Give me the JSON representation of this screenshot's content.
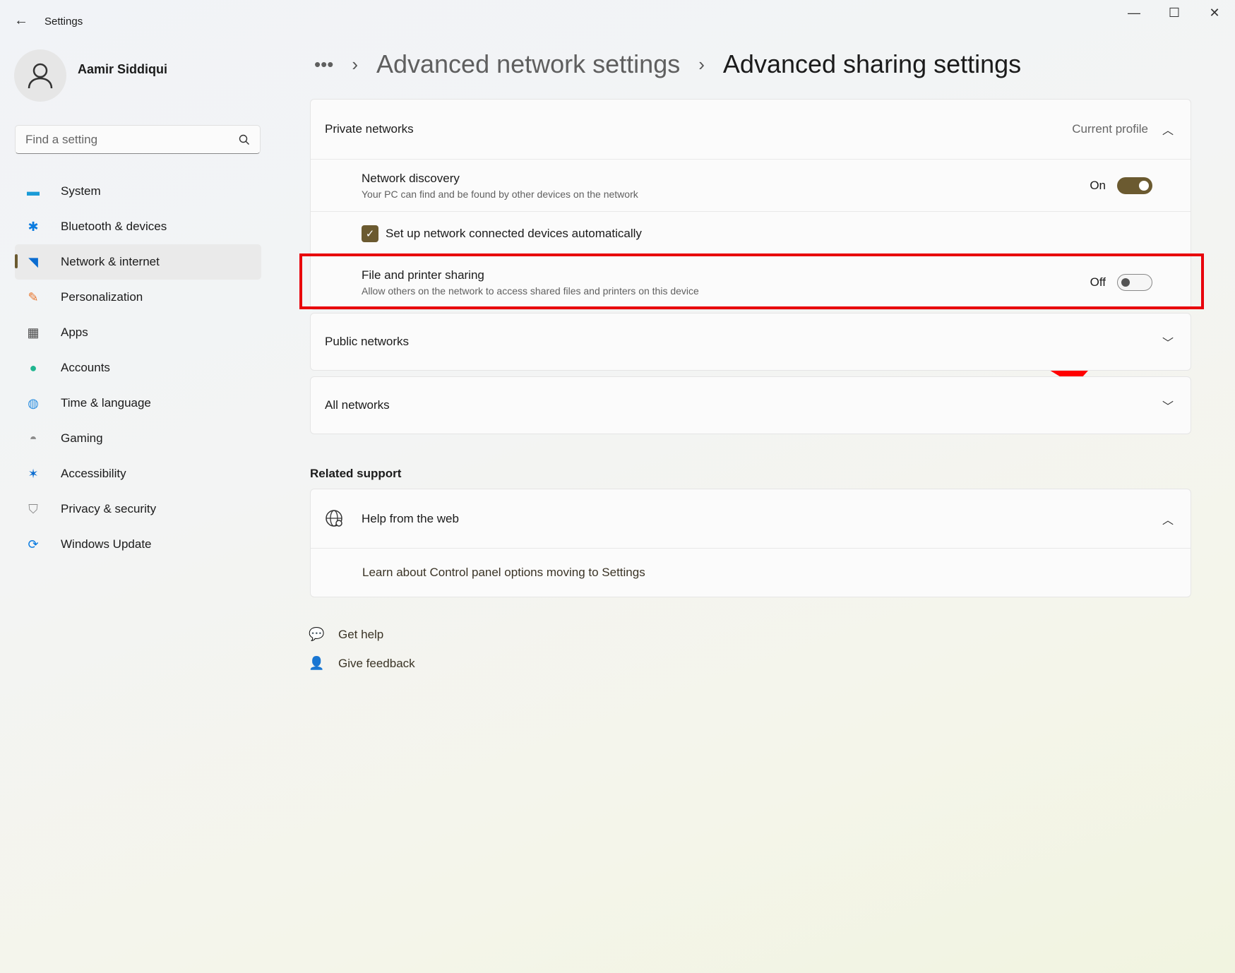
{
  "window": {
    "title": "Settings",
    "minimize": "—",
    "maximize": "☐",
    "close": "✕"
  },
  "user": {
    "name": "Aamir Siddiqui"
  },
  "search": {
    "placeholder": "Find a setting"
  },
  "nav": [
    {
      "label": "System",
      "icon": "system-icon",
      "color": "#1a9bd7"
    },
    {
      "label": "Bluetooth & devices",
      "icon": "bluetooth-icon",
      "color": "#0a7be0"
    },
    {
      "label": "Network & internet",
      "icon": "wifi-icon",
      "color": "#0a6cd0",
      "selected": true
    },
    {
      "label": "Personalization",
      "icon": "brush-icon",
      "color": "#e8742a"
    },
    {
      "label": "Apps",
      "icon": "apps-icon",
      "color": "#4a4a4a"
    },
    {
      "label": "Accounts",
      "icon": "accounts-icon",
      "color": "#1fb58f"
    },
    {
      "label": "Time & language",
      "icon": "globe-clock-icon",
      "color": "#2a8ee0"
    },
    {
      "label": "Gaming",
      "icon": "gamepad-icon",
      "color": "#8a8a8a"
    },
    {
      "label": "Accessibility",
      "icon": "accessibility-icon",
      "color": "#0a6cd0"
    },
    {
      "label": "Privacy & security",
      "icon": "shield-icon",
      "color": "#8a8a8a"
    },
    {
      "label": "Windows Update",
      "icon": "update-icon",
      "color": "#0a7be0"
    }
  ],
  "breadcrumb": {
    "more": "•••",
    "parent": "Advanced network settings",
    "current": "Advanced sharing settings"
  },
  "private": {
    "title": "Private networks",
    "badge": "Current profile",
    "discovery": {
      "title": "Network discovery",
      "desc": "Your PC can find and be found by other devices on the network",
      "state": "On"
    },
    "auto_setup": {
      "label": "Set up network connected devices automatically",
      "checked": true
    },
    "sharing": {
      "title": "File and printer sharing",
      "desc": "Allow others on the network to access shared files and printers on this device",
      "state": "Off"
    }
  },
  "public": {
    "title": "Public networks"
  },
  "all": {
    "title": "All networks"
  },
  "related": {
    "heading": "Related support",
    "help_title": "Help from the web",
    "link": "Learn about Control panel options moving to Settings"
  },
  "footer": {
    "get_help": "Get help",
    "feedback": "Give feedback"
  },
  "accent": "#6b5a30",
  "highlight": "#e8000b"
}
